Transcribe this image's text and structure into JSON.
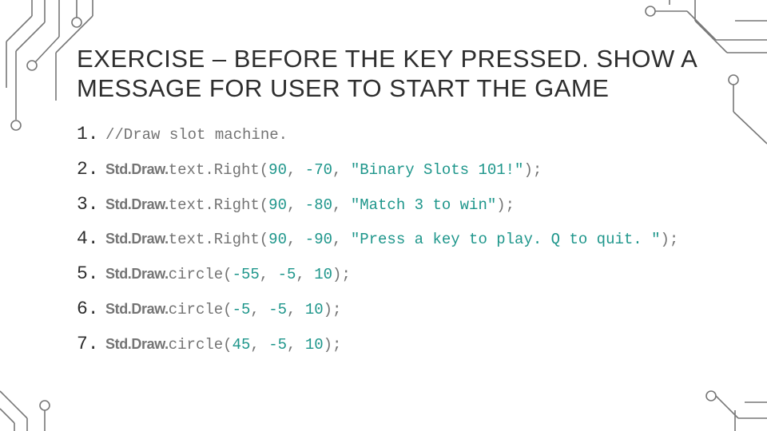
{
  "title": "EXERCISE – BEFORE THE KEY PRESSED. SHOW A MESSAGE FOR USER TO START THE GAME",
  "lines": [
    {
      "n": "1.",
      "comment": "//Draw slot machine."
    },
    {
      "n": "2.",
      "call": "Std.Draw.",
      "fn": "text.Right(",
      "a1": "90",
      "s1": ", ",
      "a2": "-70",
      "s2": ", ",
      "str": "\"Binary Slots 101!\"",
      "tail": ");"
    },
    {
      "n": "3.",
      "call": "Std.Draw.",
      "fn": "text.Right(",
      "a1": "90",
      "s1": ", ",
      "a2": "-80",
      "s2": ", ",
      "str": "\"Match 3 to win\"",
      "tail": ");"
    },
    {
      "n": "4.",
      "call": "Std.Draw.",
      "fn": "text.Right(",
      "a1": "90",
      "s1": ", ",
      "a2": "-90",
      "s2": ", ",
      "str": "\"Press a key to play. Q to quit. \"",
      "tail": ");"
    },
    {
      "n": "5.",
      "call": "Std.Draw.",
      "fn": "circle(",
      "a1": "-55",
      "s1": ", ",
      "a2": "-5",
      "s2": ", ",
      "a3": "10",
      "tail": ");"
    },
    {
      "n": "6.",
      "call": "Std.Draw.",
      "fn": "circle(",
      "a1": "-5",
      "s1": ", ",
      "a2": "-5",
      "s2": ", ",
      "a3": "10",
      "tail": ");"
    },
    {
      "n": "7.",
      "call": "Std.Draw.",
      "fn": "circle(",
      "a1": "45",
      "s1": ", ",
      "a2": "-5",
      "s2": ", ",
      "a3": "10",
      "tail": ");"
    }
  ]
}
